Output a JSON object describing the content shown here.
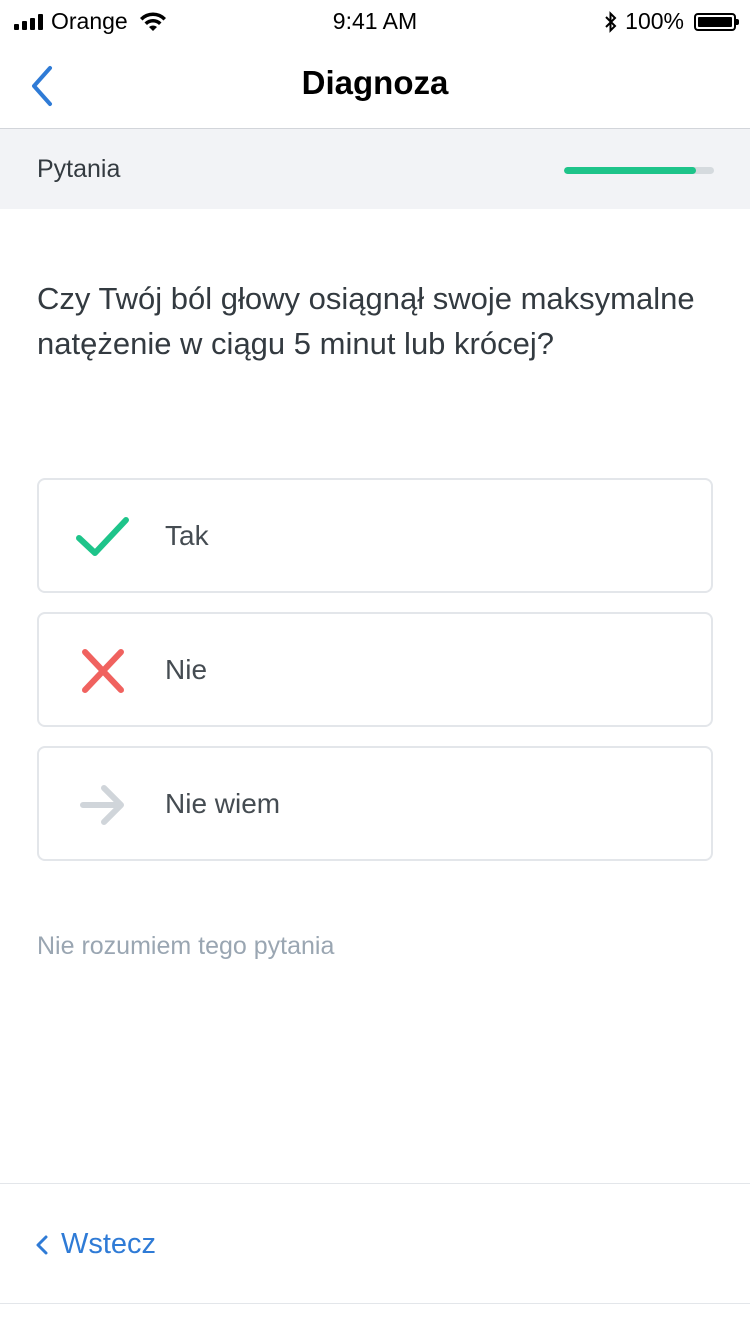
{
  "status_bar": {
    "carrier": "Orange",
    "time": "9:41 AM",
    "battery": "100%"
  },
  "nav": {
    "title": "Diagnoza"
  },
  "progress": {
    "label": "Pytania",
    "value": 0.88,
    "color": "#1ec48a"
  },
  "question": "Czy Twój ból głowy osiągnął swoje maksymalne natężenie w ciągu 5 minut lub krócej?",
  "answers": [
    {
      "label": "Tak",
      "icon": "checkmark-icon",
      "color": "#1ec48a"
    },
    {
      "label": "Nie",
      "icon": "cross-icon",
      "color": "#f0625f"
    },
    {
      "label": "Nie wiem",
      "icon": "arrow-right-icon",
      "color": "#d0d5da"
    }
  ],
  "help_link": "Nie rozumiem tego pytania",
  "footer": {
    "back_label": "Wstecz",
    "accent": "#2f7bd6"
  }
}
